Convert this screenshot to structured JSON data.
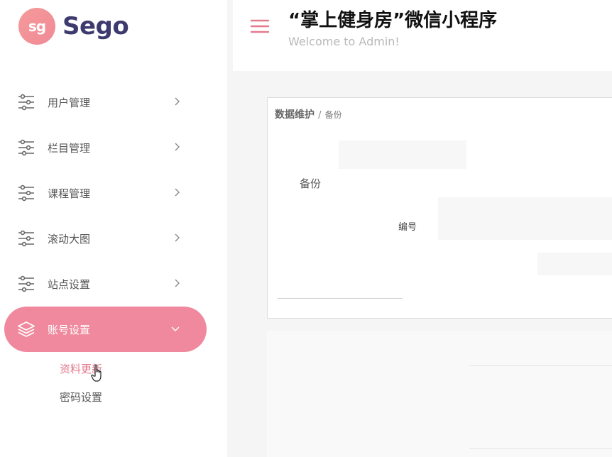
{
  "brand": {
    "badge_text": "sg",
    "name": "Sego"
  },
  "header": {
    "title": "“掌上健身房”微信小程序",
    "subtitle": "Welcome to Admin!"
  },
  "sidebar": {
    "items": [
      {
        "label": "用户管理",
        "icon": "sliders-icon"
      },
      {
        "label": "栏目管理",
        "icon": "sliders-icon"
      },
      {
        "label": "课程管理",
        "icon": "sliders-icon"
      },
      {
        "label": "滚动大图",
        "icon": "sliders-icon"
      },
      {
        "label": "站点设置",
        "icon": "sliders-icon"
      },
      {
        "label": "账号设置",
        "icon": "layers-icon",
        "active": true
      }
    ],
    "submenu": [
      {
        "label": "资料更新",
        "active": true
      },
      {
        "label": "密码设置"
      }
    ]
  },
  "content": {
    "breadcrumb_main": "数据维护",
    "breadcrumb_sep": "/",
    "breadcrumb_sub": "备份",
    "section_label": "备份",
    "column_header": "编号"
  },
  "colors": {
    "accent": "#f0899d",
    "brand_text": "#3d3b6e",
    "submenu_active": "#e37a8e",
    "hamburger": "#e37a8e"
  }
}
